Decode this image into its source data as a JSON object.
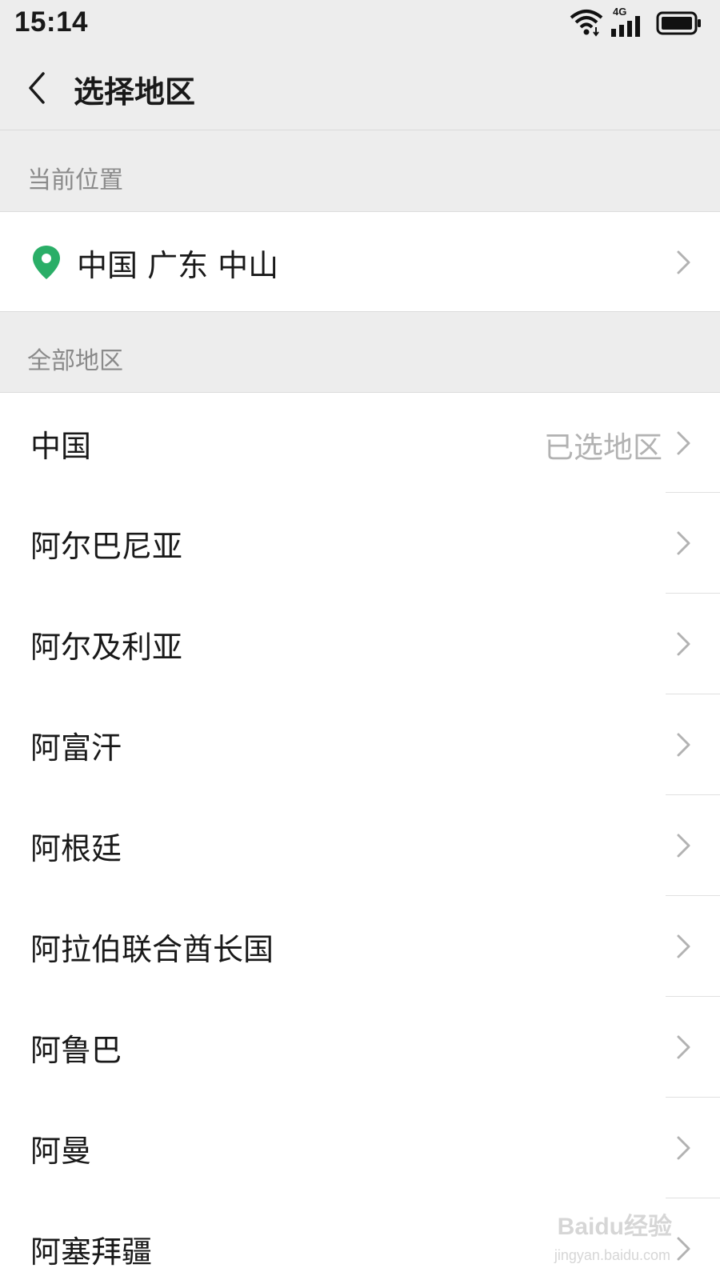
{
  "status_bar": {
    "time": "15:14",
    "network": "4G",
    "icons": [
      "wifi-icon",
      "signal-icon",
      "battery-icon"
    ]
  },
  "nav": {
    "title": "选择地区",
    "back_icon": "chevron-left-icon"
  },
  "current_location": {
    "header": "当前位置",
    "value": "中国 广东 中山",
    "icon": "location-pin-icon",
    "icon_color": "#2aae67"
  },
  "all_regions": {
    "header": "全部地区",
    "items": [
      {
        "label": "中国",
        "note": "已选地区"
      },
      {
        "label": "阿尔巴尼亚",
        "note": ""
      },
      {
        "label": "阿尔及利亚",
        "note": ""
      },
      {
        "label": "阿富汗",
        "note": ""
      },
      {
        "label": "阿根廷",
        "note": ""
      },
      {
        "label": "阿拉伯联合酋长国",
        "note": ""
      },
      {
        "label": "阿鲁巴",
        "note": ""
      },
      {
        "label": "阿曼",
        "note": ""
      },
      {
        "label": "阿塞拜疆",
        "note": ""
      }
    ]
  },
  "watermark": {
    "main": "Baidu经验",
    "sub": "jingyan.baidu.com"
  }
}
